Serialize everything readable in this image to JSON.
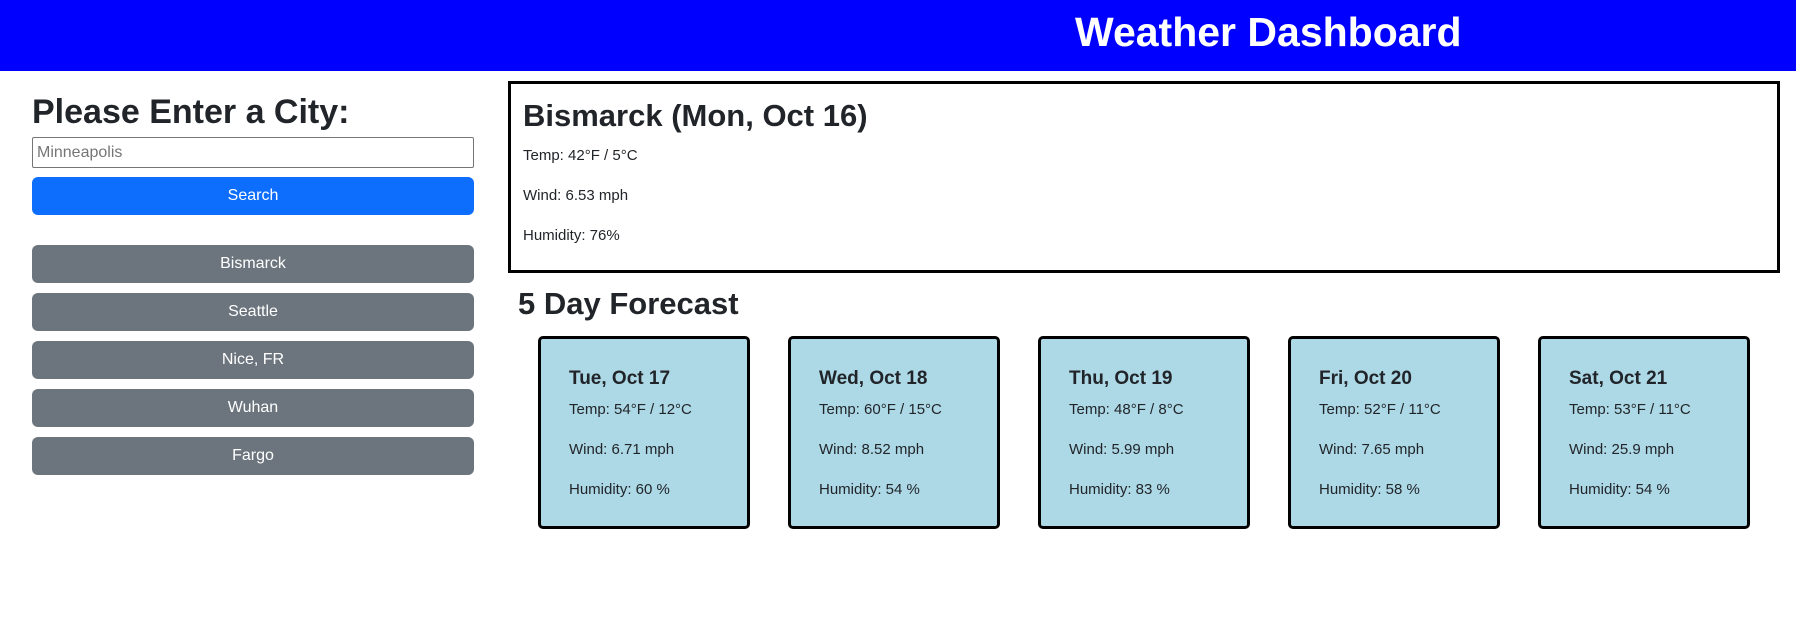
{
  "header": {
    "title": "Weather Dashboard"
  },
  "sidebar": {
    "heading": "Please Enter a City:",
    "search_input": {
      "value": "",
      "placeholder": "Minneapolis"
    },
    "search_label": "Search",
    "history": [
      "Bismarck",
      "Seattle",
      "Nice, FR",
      "Wuhan",
      "Fargo"
    ]
  },
  "current": {
    "title": "Bismarck (Mon, Oct 16)",
    "temp": "Temp: 42°F / 5°C",
    "wind": "Wind: 6.53 mph",
    "humidity": "Humidity: 76%"
  },
  "forecast": {
    "heading": "5 Day Forecast",
    "days": [
      {
        "date": "Tue, Oct 17",
        "temp": "Temp: 54°F / 12°C",
        "wind": "Wind: 6.71 mph",
        "humidity": "Humidity: 60 %"
      },
      {
        "date": "Wed, Oct 18",
        "temp": "Temp: 60°F / 15°C",
        "wind": "Wind: 8.52 mph",
        "humidity": "Humidity: 54 %"
      },
      {
        "date": "Thu, Oct 19",
        "temp": "Temp: 48°F / 8°C",
        "wind": "Wind: 5.99 mph",
        "humidity": "Humidity: 83 %"
      },
      {
        "date": "Fri, Oct 20",
        "temp": "Temp: 52°F / 11°C",
        "wind": "Wind: 7.65 mph",
        "humidity": "Humidity: 58 %"
      },
      {
        "date": "Sat, Oct 21",
        "temp": "Temp: 53°F / 11°C",
        "wind": "Wind: 25.9 mph",
        "humidity": "Humidity: 54 %"
      }
    ]
  },
  "colors": {
    "header_bg": "#0000ff",
    "search_button": "#0d6efd",
    "history_button": "#6c757d",
    "forecast_card": "#add8e6"
  }
}
